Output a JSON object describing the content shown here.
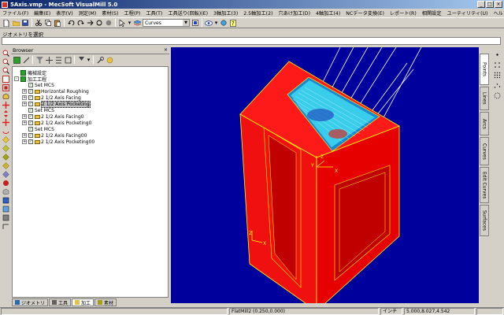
{
  "window": {
    "title": "5Axis.vmp - MecSoft VisualMill 5.0",
    "buttons": {
      "minimize": "_",
      "maximize": "□",
      "close": "×"
    }
  },
  "menu": [
    "ファイル(F)",
    "編集(E)",
    "表示(V)",
    "測定(M)",
    "素材(S)",
    "工程(P)",
    "工具(T)",
    "工具送り(回転)(E)",
    "3軸加工(3)",
    "2.5軸加工(2)",
    "穴あけ加工(D)",
    "4軸加工(4)",
    "NCデータ変換(E)",
    "レポート(R)",
    "相関設定",
    "ユーティリティ(U)",
    "ヘルプ(H)"
  ],
  "toolbar": {
    "layer_combo": "Curves"
  },
  "command": {
    "prompt": "ジオメトリを選択",
    "value": ""
  },
  "browser": {
    "title": "Browser",
    "close": "×",
    "tree": [
      {
        "label": "機械設定",
        "level": 0,
        "icon": "cube",
        "expand": ""
      },
      {
        "label": "加工工程",
        "level": 0,
        "icon": "cube",
        "expand": "-"
      },
      {
        "label": "Set MCS",
        "level": 1,
        "icon": "check",
        "expand": ""
      },
      {
        "label": "Horizontal Roughing",
        "level": 1,
        "icon": "folder",
        "expand": "+"
      },
      {
        "label": "2 1/2 Axis Facing",
        "level": 1,
        "icon": "folder",
        "expand": "+"
      },
      {
        "label": "2 1/2 Axis Pocketing",
        "level": 1,
        "icon": "folder",
        "expand": "+",
        "selected": true
      },
      {
        "label": "Set MCS",
        "level": 1,
        "icon": "check",
        "expand": ""
      },
      {
        "label": "2 1/2 Axis Facing0",
        "level": 1,
        "icon": "folder",
        "expand": "+"
      },
      {
        "label": "2 1/2 Axis Pocketing0",
        "level": 1,
        "icon": "folder",
        "expand": "+"
      },
      {
        "label": "Set MCS",
        "level": 1,
        "icon": "check",
        "expand": ""
      },
      {
        "label": "2 1/2 Axis Facing00",
        "level": 1,
        "icon": "folder",
        "expand": "+"
      },
      {
        "label": "2 1/2 Axis Pocketing00",
        "level": 1,
        "icon": "folder",
        "expand": "+"
      }
    ],
    "tabs": [
      {
        "label": "ジオメトリ",
        "active": false
      },
      {
        "label": "工具",
        "active": false
      },
      {
        "label": "加工",
        "active": true
      },
      {
        "label": "素材",
        "active": false
      }
    ]
  },
  "right_tabs": [
    {
      "label": "Points",
      "active": true
    },
    {
      "label": "Lines",
      "active": false
    },
    {
      "label": "Arcs",
      "active": false
    },
    {
      "label": "Curves",
      "active": false
    },
    {
      "label": "Edit Curves",
      "active": false
    },
    {
      "label": "Surfaces",
      "active": false
    }
  ],
  "viewport": {
    "axis_labels": {
      "x": "X",
      "y": "Y",
      "z": "Z"
    },
    "colors": {
      "background": "#00009c",
      "part": "#ff0000",
      "edges": "#ffff00",
      "toolpath": "#00e0ff"
    }
  },
  "status": {
    "left": "",
    "mode": "FlatMill2 (0.250,0.000)",
    "unit": "インチ",
    "coords": "5.000,8.027,4.542"
  }
}
